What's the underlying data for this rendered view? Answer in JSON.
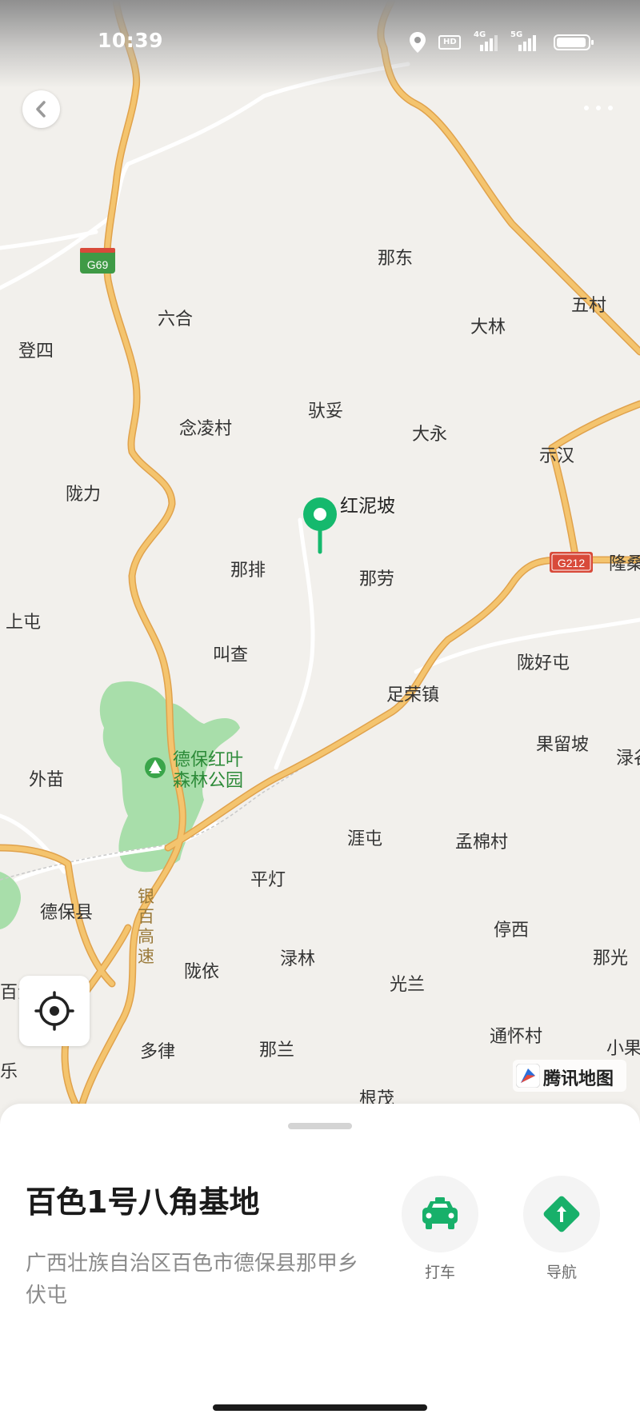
{
  "status_bar": {
    "time": "10:39",
    "icons": [
      "location-icon",
      "hd-icon",
      "4g-signal-icon",
      "5g-signal-icon",
      "battery-icon"
    ],
    "hd_label": "HD",
    "sig1_label": "4G",
    "sig2_label": "5G"
  },
  "map": {
    "colors": {
      "land": "#f2f0ec",
      "highway": "#f4c46e",
      "highway_outline": "#e0a24c",
      "road": "#ffffff",
      "park": "#a8deaa",
      "pin": "#15b96d"
    },
    "road_shields": [
      "G69",
      "G212"
    ],
    "labels": [
      {
        "text": "那东"
      },
      {
        "text": "五村"
      },
      {
        "text": "大林"
      },
      {
        "text": "六合"
      },
      {
        "text": "登四"
      },
      {
        "text": "驮妥"
      },
      {
        "text": "念凌村"
      },
      {
        "text": "大永"
      },
      {
        "text": "示汉"
      },
      {
        "text": "陇力"
      },
      {
        "text": "红泥坡"
      },
      {
        "text": "隆桑"
      },
      {
        "text": "那排"
      },
      {
        "text": "那劳"
      },
      {
        "text": "上屯"
      },
      {
        "text": "叫查"
      },
      {
        "text": "陇好屯"
      },
      {
        "text": "足荣镇"
      },
      {
        "text": "果留坡"
      },
      {
        "text": "渌谷"
      },
      {
        "text": "外苗"
      },
      {
        "text": "德保红叶"
      },
      {
        "text": "森林公园"
      },
      {
        "text": "涯屯"
      },
      {
        "text": "孟棉村"
      },
      {
        "text": "平灯"
      },
      {
        "text": "德保县"
      },
      {
        "text": "银"
      },
      {
        "text": "百"
      },
      {
        "text": "高"
      },
      {
        "text": "速"
      },
      {
        "text": "停西"
      },
      {
        "text": "渌林"
      },
      {
        "text": "那光"
      },
      {
        "text": "陇依"
      },
      {
        "text": "百汇"
      },
      {
        "text": "光兰"
      },
      {
        "text": "通怀村"
      },
      {
        "text": "多律"
      },
      {
        "text": "那兰"
      },
      {
        "text": "小果"
      },
      {
        "text": "乐"
      },
      {
        "text": "根茂"
      }
    ],
    "pin_label": "红泥坡",
    "watermark": "腾讯地图"
  },
  "place": {
    "name": "百色1号八角基地",
    "address": "广西壮族自治区百色市德保县那甲乡伏屯",
    "actions": [
      {
        "label": "打车",
        "icon": "taxi-icon"
      },
      {
        "label": "导航",
        "icon": "navigation-icon"
      }
    ]
  }
}
